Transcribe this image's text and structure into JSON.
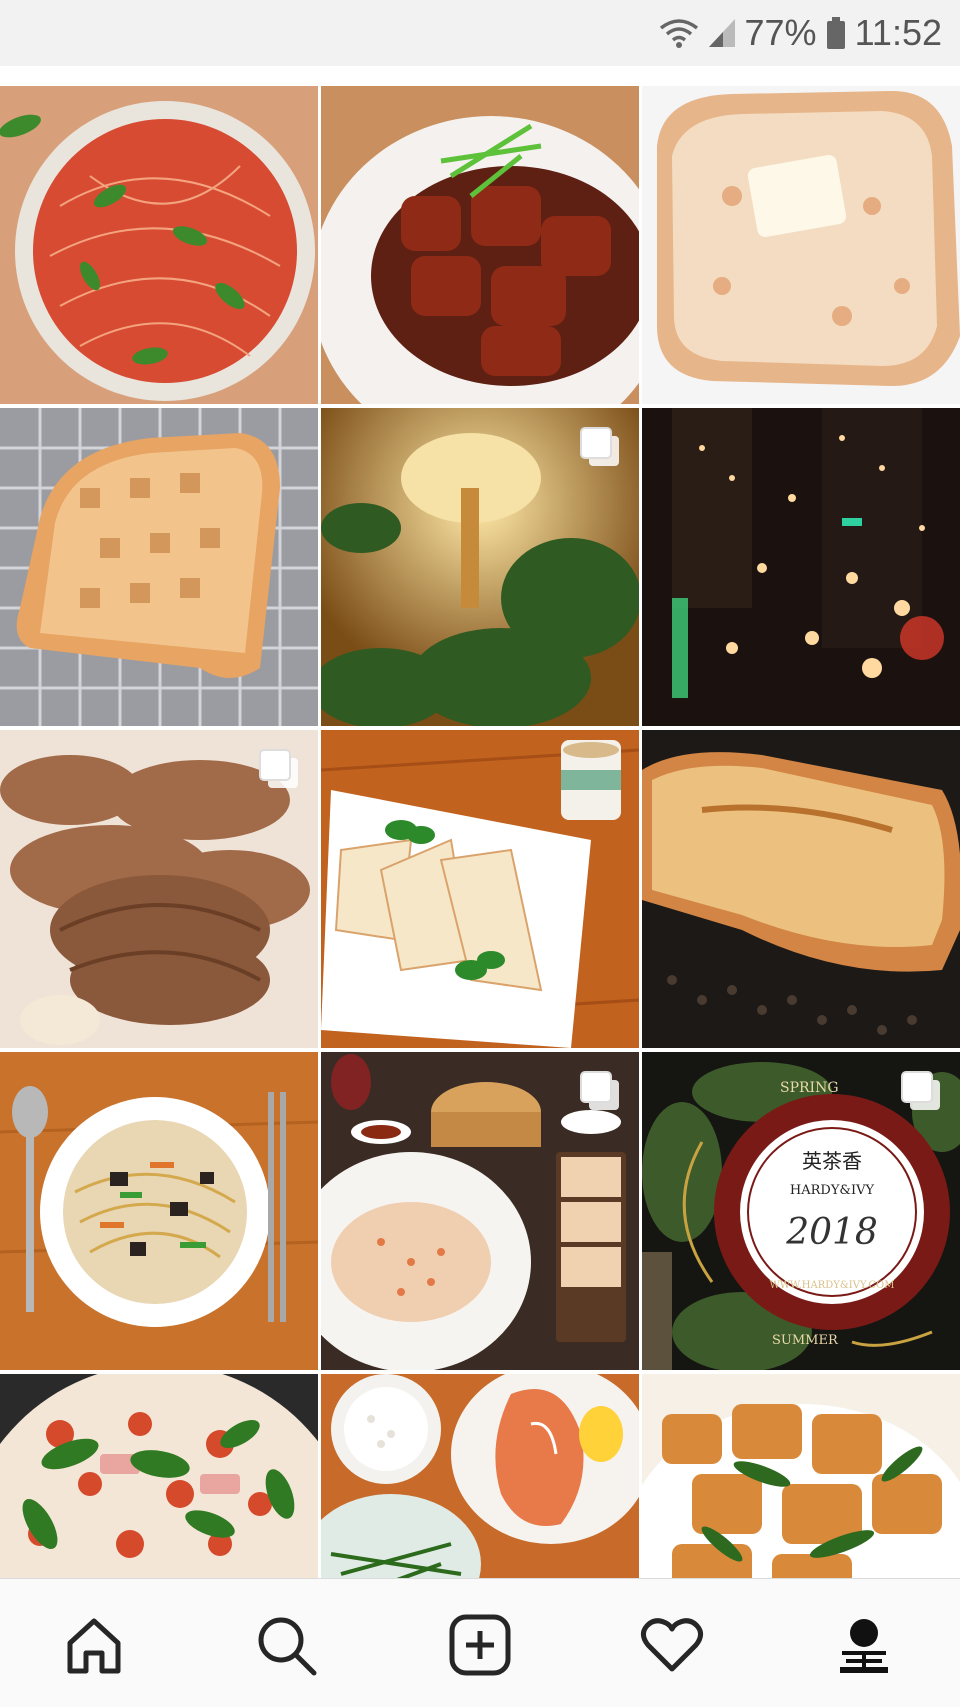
{
  "status_bar": {
    "battery_percent": "77%",
    "time": "11:52",
    "icons": [
      "wifi-icon",
      "signal-icon",
      "battery-icon"
    ]
  },
  "grid": {
    "posts": [
      {
        "subject": "tomato basil spaghetti",
        "multi": false
      },
      {
        "subject": "braised pork belly with scallions",
        "multi": false
      },
      {
        "subject": "butter toast",
        "multi": false
      },
      {
        "subject": "toast on wire rack",
        "multi": false
      },
      {
        "subject": "elephant wall lamp with plants",
        "multi": true
      },
      {
        "subject": "rainy night city lights",
        "multi": false
      },
      {
        "subject": "sliced braised pork",
        "multi": true
      },
      {
        "subject": "quesadilla with mint and milk tea",
        "multi": false
      },
      {
        "subject": "pound cake loaf",
        "multi": false
      },
      {
        "subject": "fried noodles with chopsticks",
        "multi": false
      },
      {
        "subject": "fried rice and dim sum",
        "multi": true
      },
      {
        "subject": "tea shop poster",
        "multi": true,
        "poster_texts": [
          "英茶香",
          "HARDY&IVY",
          "2018",
          "SPRING",
          "SUMMER",
          "WWW.HARDY&IVY.COM"
        ]
      },
      {
        "subject": "margherita pizza",
        "multi": false
      },
      {
        "subject": "salmon steak with rice",
        "multi": false
      },
      {
        "subject": "fried tofu with greens",
        "multi": false
      }
    ]
  },
  "nav": {
    "items": [
      "home-icon",
      "search-icon",
      "new-post-icon",
      "activity-heart-icon",
      "profile-icon"
    ]
  },
  "colors": {
    "status_bg": "#f2f2f2",
    "nav_bg": "#fafafa",
    "icon": "#262626"
  }
}
